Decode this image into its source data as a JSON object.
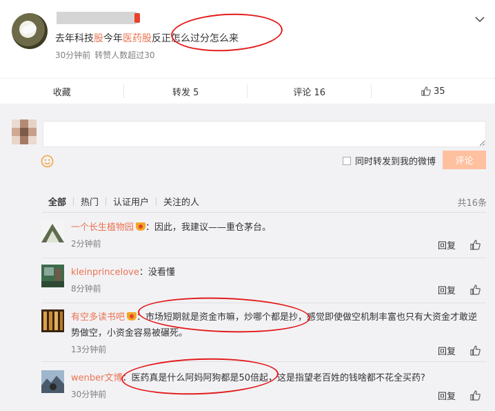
{
  "post": {
    "username": "",
    "text_parts": [
      "去年科技",
      "股",
      "今年",
      "医药股",
      "反正怎么过分怎么来"
    ],
    "time": "30分钟前",
    "repost_info": "转赞人数超过30"
  },
  "actions": {
    "favorite": "收藏",
    "repost": "转发 5",
    "comment": "评论 16",
    "like": "35"
  },
  "composer": {
    "input_placeholder": "",
    "repost_option": "同时转发到我的微博",
    "submit_label": "评论"
  },
  "filters": {
    "tabs": [
      "全部",
      "热门",
      "认证用户",
      "关注的人"
    ],
    "total": "共16条"
  },
  "comments": [
    {
      "name": "一个长生植物园",
      "badge": "crown",
      "text": "：因此，我建议——重仓茅台。",
      "time": "2分钟前",
      "reply": "回复"
    },
    {
      "name": "kleinprincelove",
      "badge": "",
      "text": "：没看懂",
      "time": "8分钟前",
      "reply": "回复"
    },
    {
      "name": "有空多读书吧",
      "badge": "crown",
      "text": "：市场短期就是资金市嘛，炒哪个都是抄，感觉即使做空机制丰富也只有大资金才敢逆势做空，小资金容易被碾死。",
      "time": "13分钟前",
      "reply": "回复"
    },
    {
      "name": "wenber文博",
      "badge": "",
      "text": "：医药真是什么阿妈阿狗都是50倍起，这是指望老百姓的钱啥都不花全买药?",
      "time": "30分钟前",
      "reply": "回复"
    }
  ],
  "colors": {
    "accent": "#eb7350",
    "button": "#ffc09f",
    "annotation": "#e31b1b",
    "panel_bg": "#f2f2f5"
  }
}
